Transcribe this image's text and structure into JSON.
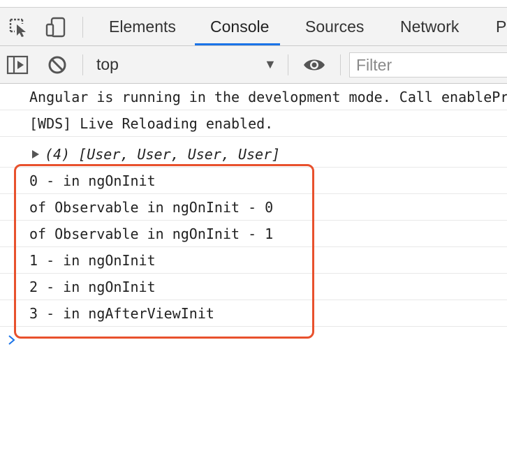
{
  "tabs": [
    {
      "label": "Elements"
    },
    {
      "label": "Console"
    },
    {
      "label": "Sources"
    },
    {
      "label": "Network"
    },
    {
      "label": "P"
    }
  ],
  "toolbar": {
    "context": "top",
    "filter_placeholder": "Filter"
  },
  "console": {
    "messages": [
      {
        "text": "Angular is running in the development mode. Call enableProdMode()"
      },
      {
        "text": "[WDS] Live Reloading enabled."
      },
      {
        "text": "(4) [User, User, User, User]"
      },
      {
        "text": "0 - in ngOnInit"
      },
      {
        "text": "of Observable in ngOnInit - 0"
      },
      {
        "text": "of Observable in ngOnInit - 1"
      },
      {
        "text": "1 - in ngOnInit"
      },
      {
        "text": "2 - in ngOnInit"
      },
      {
        "text": "3 - in ngAfterViewInit"
      }
    ]
  },
  "colors": {
    "accent": "#1a73e8",
    "highlight": "#e8512d"
  }
}
